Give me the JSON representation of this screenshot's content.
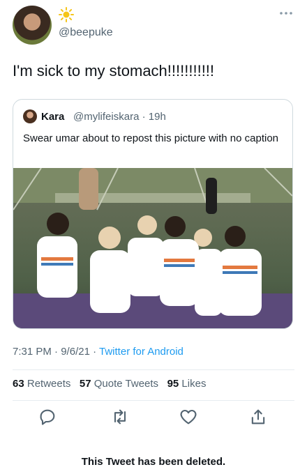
{
  "author": {
    "handle": "@beepuke",
    "avatar_icon": "user-avatar",
    "emoji_icon": "sun-emoji"
  },
  "tweet": {
    "text": "I'm sick to my stomach!!!!!!!!!!!"
  },
  "quoted": {
    "name": "Kara",
    "handle": "@mylifeiskara",
    "time": "· 19h",
    "text": "Swear umar about to repost this picture with no caption",
    "image_alt": "photo of group on football field"
  },
  "meta": {
    "time": "7:31 PM",
    "date": "9/6/21",
    "source": "Twitter for Android"
  },
  "stats": {
    "retweets_count": "63",
    "retweets_label": "Retweets",
    "quotes_count": "57",
    "quotes_label": "Quote Tweets",
    "likes_count": "95",
    "likes_label": "Likes"
  },
  "actions": [
    "reply-icon",
    "retweet-icon",
    "like-icon",
    "share-icon"
  ],
  "footer": {
    "deleted": "This Tweet has been deleted."
  },
  "colors": {
    "link": "#1d9bf0",
    "muted": "#536471",
    "text": "#0f1419",
    "border": "#cfd9de"
  }
}
